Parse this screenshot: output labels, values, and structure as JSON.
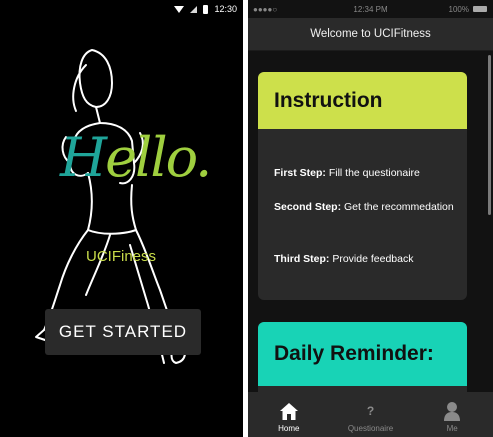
{
  "left_screen": {
    "status_time": "12:30",
    "hello": {
      "first_letter": "H",
      "rest": "ello."
    },
    "brand": "UCIFiness",
    "get_started_label": "GET STARTED",
    "colors": {
      "hello_teal": "#1fa59a",
      "hello_green": "#9fcf3f",
      "brand": "#c9dc4a"
    }
  },
  "right_screen": {
    "status": {
      "carrier_dots": "●●●●○",
      "time": "12:34 PM",
      "battery_pct": "100%"
    },
    "nav_title": "Welcome to UCIFitness",
    "instruction_card": {
      "title": "Instruction",
      "steps": [
        {
          "label": "First Step:",
          "text": "Fill the questionaire"
        },
        {
          "label": "Second Step:",
          "text": "Get the recommedation"
        },
        {
          "label": "Third Step:",
          "text": "Provide feedback"
        }
      ],
      "color": "#cde04b"
    },
    "reminder_card": {
      "title": "Daily Reminder:",
      "color": "#18d3b6"
    },
    "tabs": [
      {
        "label": "Home",
        "icon": "home-icon"
      },
      {
        "label": "Questionaire",
        "icon": "question-icon",
        "glyph": "?"
      },
      {
        "label": "Me",
        "icon": "person-icon"
      }
    ]
  }
}
